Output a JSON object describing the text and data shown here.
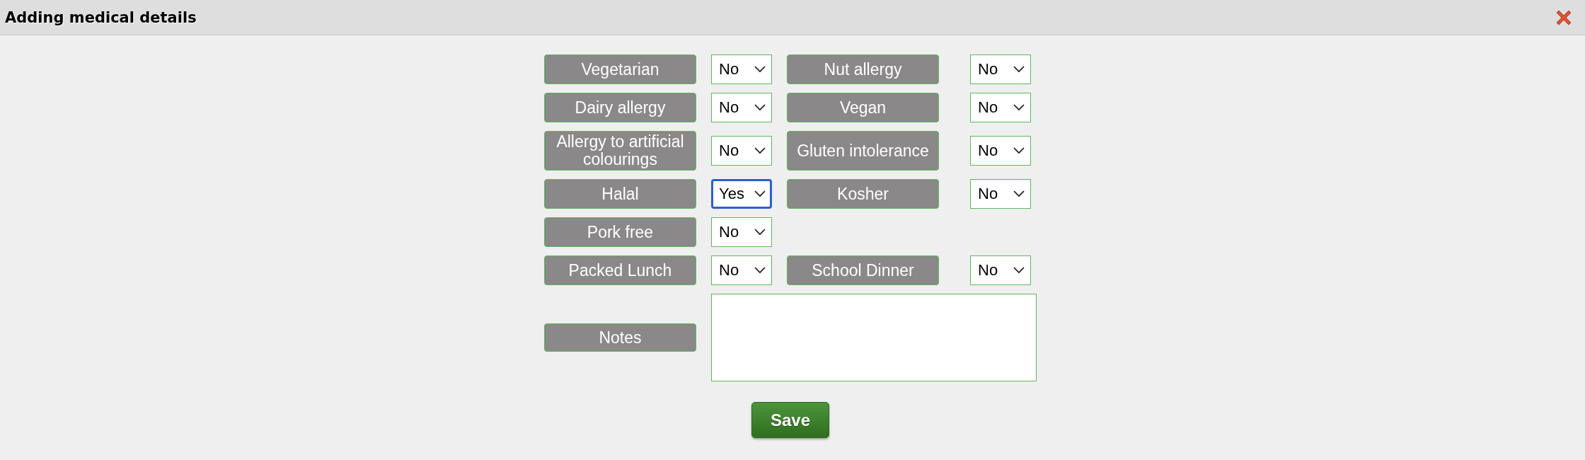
{
  "window": {
    "title": "Adding medical details"
  },
  "rows": [
    {
      "fields": [
        {
          "label": "Vegetarian",
          "value": "No",
          "focused": false
        },
        {
          "label": "Nut allergy",
          "value": "No",
          "focused": false
        }
      ]
    },
    {
      "fields": [
        {
          "label": "Dairy allergy",
          "value": "No",
          "focused": false
        },
        {
          "label": "Vegan",
          "value": "No",
          "focused": false
        }
      ]
    },
    {
      "fields": [
        {
          "label": "Allergy to artificial colourings",
          "value": "No",
          "focused": false
        },
        {
          "label": "Gluten intolerance",
          "value": "No",
          "focused": false
        }
      ]
    },
    {
      "fields": [
        {
          "label": "Halal",
          "value": "Yes",
          "focused": true
        },
        {
          "label": "Kosher",
          "value": "No",
          "focused": false
        }
      ]
    },
    {
      "fields": [
        {
          "label": "Pork free",
          "value": "No",
          "focused": false
        }
      ]
    },
    {
      "fields": [
        {
          "label": "Packed Lunch",
          "value": "No",
          "focused": false
        },
        {
          "label": "School Dinner",
          "value": "No",
          "focused": false
        }
      ]
    }
  ],
  "notes": {
    "label": "Notes"
  },
  "buttons": [
    "Save"
  ]
}
